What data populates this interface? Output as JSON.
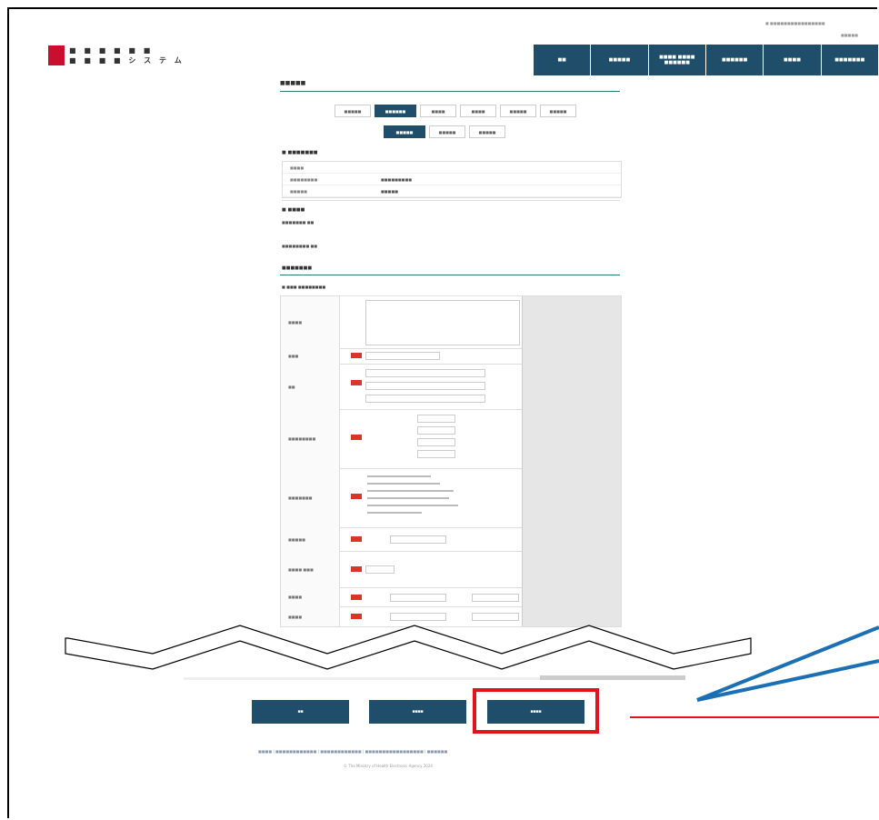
{
  "header": {
    "logo_text_line1": "■ ■ ■ ■ ■ ■",
    "logo_text_line2": "■ ■ ■ ■ シ ス テ ム",
    "top_link": "■ ■■■■■■■■■■■■■■■■",
    "top_link2": "■■■■■",
    "nav": [
      "■■",
      "■■■■■",
      "■■■■ ■■■■\n■■■■■■",
      "■■■■■■",
      "■■■■",
      "■■■■■■■"
    ]
  },
  "page": {
    "title": "■■■■■",
    "steps_top": [
      "■■■■■",
      "■■■■■■",
      "■■■■",
      "■■■■",
      "■■■■■",
      "■■■■■"
    ],
    "steps_sub": [
      "■■■■■",
      "■■■■■",
      "■■■■■"
    ],
    "section1_title": "■ ■■■■■■■",
    "kv_rows": [
      [
        "■■■■",
        ""
      ],
      [
        "■■■■■■■■",
        "■■■■■■■■■"
      ],
      [
        "■■■■■",
        "■■■■■"
      ]
    ],
    "section2_title": "■ ■■■■",
    "section2_line1": "■■■■■■■ ■■",
    "section2_line2": "■■■■■■■■ ■■",
    "section3_title": "■■■■■■■",
    "section3_sub": "■ ■■■ ■■■■■■■■"
  },
  "form_rows": [
    {
      "label": "■■■■"
    },
    {
      "label": "■■■"
    },
    {
      "label": "■■"
    },
    {
      "label": "■■■■■■■■"
    },
    {
      "label": "■■■■■■■"
    },
    {
      "label": "■■■■■"
    },
    {
      "label": "■■■■ ■■■"
    },
    {
      "label": "■■■■"
    },
    {
      "label": "■■■■"
    }
  ],
  "buttons": {
    "back": "■■",
    "save": "■■■■",
    "confirm": "■■■■"
  },
  "footer": {
    "links": "■■■■ | ■■■■■■■■■■■■ | ■■■■■■■■■■■■ | ■■■■■■■■■■■■■■■■■ | ■■■■■■",
    "copyright": "© The Ministry of Health Electronic Agency 2024"
  },
  "colors": {
    "nav_bg": "#1f4e6b",
    "highlight": "#e0141b",
    "arrow": "#1a6fb5",
    "required": "#d9362b"
  }
}
